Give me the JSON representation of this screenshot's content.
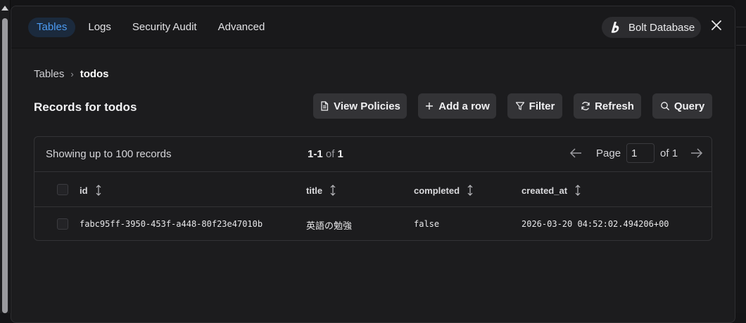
{
  "tabs": [
    "Tables",
    "Logs",
    "Security Audit",
    "Advanced"
  ],
  "database_label": "Bolt Database",
  "breadcrumb": {
    "root": "Tables",
    "separator": "›",
    "current": "todos"
  },
  "records_title": "Records for todos",
  "toolbar": {
    "view_policies": "View Policies",
    "add_row": "Add a row",
    "filter": "Filter",
    "refresh": "Refresh",
    "query": "Query"
  },
  "pagination": {
    "showing": "Showing up to 100 records",
    "range": "1-1",
    "of_word": "of",
    "total": "1",
    "page_label": "Page",
    "page_value": "1",
    "of_pages": "of 1"
  },
  "columns": [
    "id",
    "title",
    "completed",
    "created_at"
  ],
  "rows": [
    {
      "id": "fabc95ff-3950-453f-a448-80f23e47010b",
      "title": "英語の勉強",
      "completed": "false",
      "created_at": "2026-03-20 04:52:02.494206+00"
    }
  ],
  "colors": {
    "accent": "#4c9bf2",
    "panel": "#1c1c1e",
    "button": "#333336"
  }
}
